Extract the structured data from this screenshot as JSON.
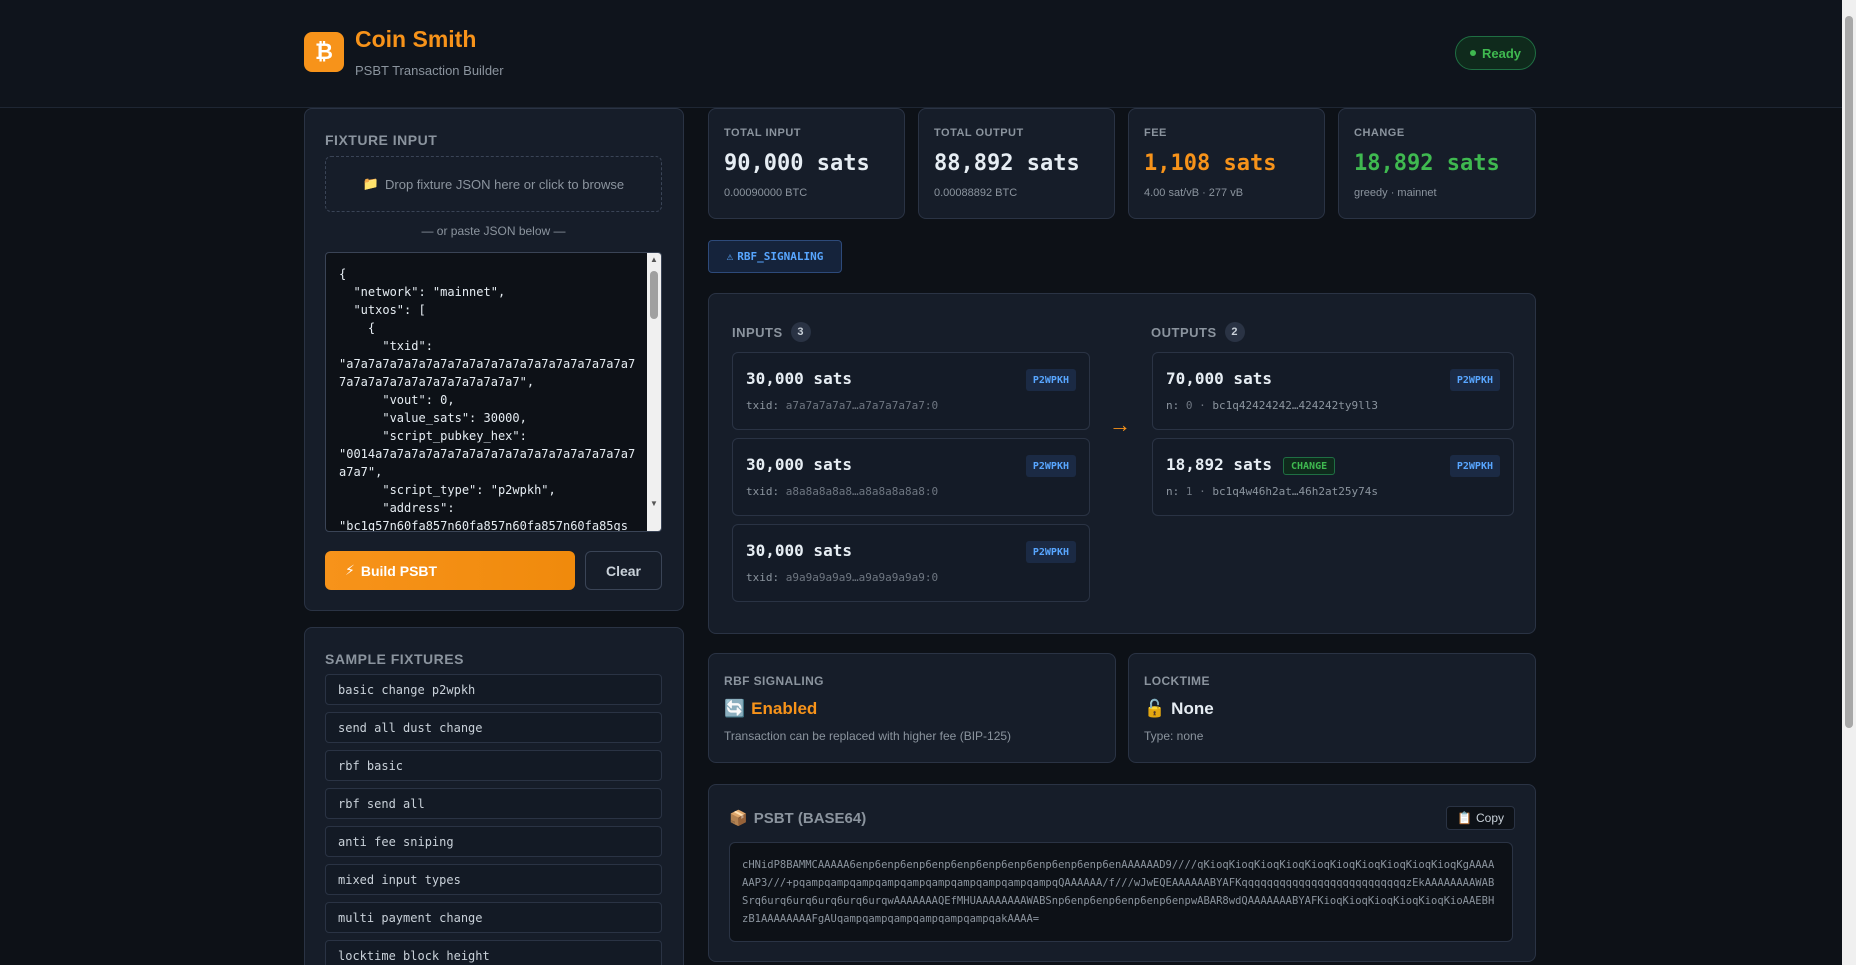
{
  "header": {
    "logo_glyph": "₿",
    "title": "Coin Smith",
    "subtitle": "PSBT Transaction Builder",
    "status": "Ready"
  },
  "fixture_input": {
    "title": "FIXTURE INPUT",
    "dropzone_icon": "📁",
    "dropzone_text": "Drop fixture JSON here or click to browse",
    "or_paste": "— or paste JSON below —",
    "json_text": "{\n  \"network\": \"mainnet\",\n  \"utxos\": [\n    {\n      \"txid\":\n\"a7a7a7a7a7a7a7a7a7a7a7a7a7a7a7a7a7a7a7a7\n7a7a7a7a7a7a7a7a7a7a7a7a7\",\n      \"vout\": 0,\n      \"value_sats\": 30000,\n      \"script_pubkey_hex\":\n\"0014a7a7a7a7a7a7a7a7a7a7a7a7a7a7a7a7a7a7\na7a7\",\n      \"script_type\": \"p2wpkh\",\n      \"address\":\n\"bc1q57n60fa857n60fa857n60fa857n60fa85gs",
    "build_icon": "⚡",
    "build_label": "Build PSBT",
    "clear_label": "Clear"
  },
  "sample_fixtures": {
    "title": "SAMPLE FIXTURES",
    "items": [
      "basic change p2wpkh",
      "send all dust change",
      "rbf basic",
      "rbf send all",
      "anti fee sniping",
      "mixed input types",
      "multi payment change",
      "locktime block height"
    ]
  },
  "stats": [
    {
      "label": "TOTAL INPUT",
      "value": "90,000 sats",
      "sub": "0.00090000 BTC",
      "color": "#e6edf3"
    },
    {
      "label": "TOTAL OUTPUT",
      "value": "88,892 sats",
      "sub": "0.00088892 BTC",
      "color": "#e6edf3"
    },
    {
      "label": "FEE",
      "value": "1,108 sats",
      "sub": "4.00 sat/vB · 277 vB",
      "color": "#f7931a"
    },
    {
      "label": "CHANGE",
      "value": "18,892 sats",
      "sub": "greedy · mainnet",
      "color": "#3fb950"
    }
  ],
  "rbf_tag": {
    "icon": "⚠",
    "label": "RBF_SIGNALING"
  },
  "inputs": {
    "label": "INPUTS",
    "count": "3",
    "items": [
      {
        "amount": "30,000 sats",
        "type": "P2WPKH",
        "key": "txid:",
        "value": "a7a7a7a7a7…a7a7a7a7a7:0"
      },
      {
        "amount": "30,000 sats",
        "type": "P2WPKH",
        "key": "txid:",
        "value": "a8a8a8a8a8…a8a8a8a8a8:0"
      },
      {
        "amount": "30,000 sats",
        "type": "P2WPKH",
        "key": "txid:",
        "value": "a9a9a9a9a9…a9a9a9a9a9:0"
      }
    ]
  },
  "arrow": "→",
  "outputs": {
    "label": "OUTPUTS",
    "count": "2",
    "items": [
      {
        "amount": "70,000 sats",
        "type": "P2WPKH",
        "key": "n:",
        "n": "0",
        "sep": "·",
        "address": "bc1q42424242…424242ty9ll3"
      },
      {
        "amount": "18,892 sats",
        "type": "P2WPKH",
        "change": "CHANGE",
        "key": "n:",
        "n": "1",
        "sep": "·",
        "address": "bc1q4w46h2at…46h2at25y74s"
      }
    ]
  },
  "rbf_signaling": {
    "label": "RBF SIGNALING",
    "icon": "🔄",
    "value": "Enabled",
    "desc": "Transaction can be replaced with higher fee (BIP-125)"
  },
  "locktime": {
    "label": "LOCKTIME",
    "icon": "🔓",
    "value": "None",
    "desc": "Type: none"
  },
  "psbt": {
    "icon": "📦",
    "title": "PSBT (BASE64)",
    "copy_icon": "📋",
    "copy_label": "Copy",
    "value": "cHNidP8BAMMCAAAAA6enp6enp6enp6enp6enp6enp6enp6enp6enp6enp6enAAAAAAD9////qKioqKioqKioqKioqKioqKioqKioqKioqKioqKioqKgAAAAAAP3///+pqampqampqampqampqampqampqampqampqampqampqQAAAAAA/f///wJwEQEAAAAAABYAFKqqqqqqqqqqqqqqqqqqqqqqqqqqzEkAAAAAAAAWABSrq6urq6urq6urq6urq6urqwAAAAAAAQEfMHUAAAAAAAAWABSnp6enp6enp6enp6enp6enpwABAR8wdQAAAAAAABYAFKioqKioqKioqKioqKioqKioAAEBHzB1AAAAAAAAFgAUqampqampqampqampqampqampqakAAAA="
  }
}
